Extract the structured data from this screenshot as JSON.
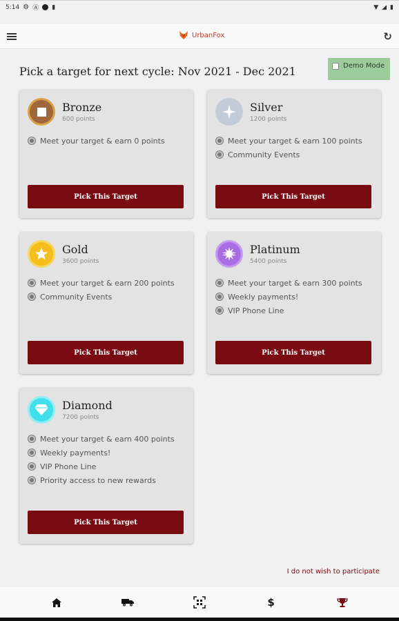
{
  "status_bar": {
    "time": "5:14"
  },
  "app_bar": {
    "brand": "UrbanFox"
  },
  "header": {
    "title": "Pick a target for next cycle: Nov 2021 - Dec 2021",
    "demo_label": "Demo Mode",
    "demo_checked": false
  },
  "tiers": [
    {
      "name": "Bronze",
      "points": "600 points",
      "icon": "bronze-square-icon",
      "color": "#a0673a",
      "benefits": [
        "Meet your target & earn 0 points"
      ],
      "button": "Pick This Target"
    },
    {
      "name": "Silver",
      "points": "1200 points",
      "icon": "silver-sparkle-icon",
      "color": "#c3ccd6",
      "benefits": [
        "Meet your target & earn 100 points",
        "Community Events"
      ],
      "button": "Pick This Target"
    },
    {
      "name": "Gold",
      "points": "3600 points",
      "icon": "gold-star-icon",
      "color": "#f4be1c",
      "benefits": [
        "Meet your target & earn 200 points",
        "Community Events"
      ],
      "button": "Pick This Target"
    },
    {
      "name": "Platinum",
      "points": "5400 points",
      "icon": "platinum-burst-icon",
      "color": "#a86de0",
      "benefits": [
        "Meet your target & earn 300 points",
        "Weekly payments!",
        "VIP Phone Line"
      ],
      "button": "Pick This Target"
    },
    {
      "name": "Diamond",
      "points": "7200 points",
      "icon": "diamond-gem-icon",
      "color": "#3fe0ec",
      "benefits": [
        "Meet your target & earn 400 points",
        "Weekly payments!",
        "VIP Phone Line",
        "Priority access to new rewards"
      ],
      "button": "Pick This Target"
    }
  ],
  "opt_out": "I do not wish to participate",
  "bottom_nav": [
    "home-icon",
    "truck-icon",
    "scan-icon",
    "dollar-icon",
    "trophy-icon"
  ],
  "colors": {
    "accent": "#7a0a12",
    "card": "#e3e3e3",
    "demo": "#9ccb9c"
  }
}
